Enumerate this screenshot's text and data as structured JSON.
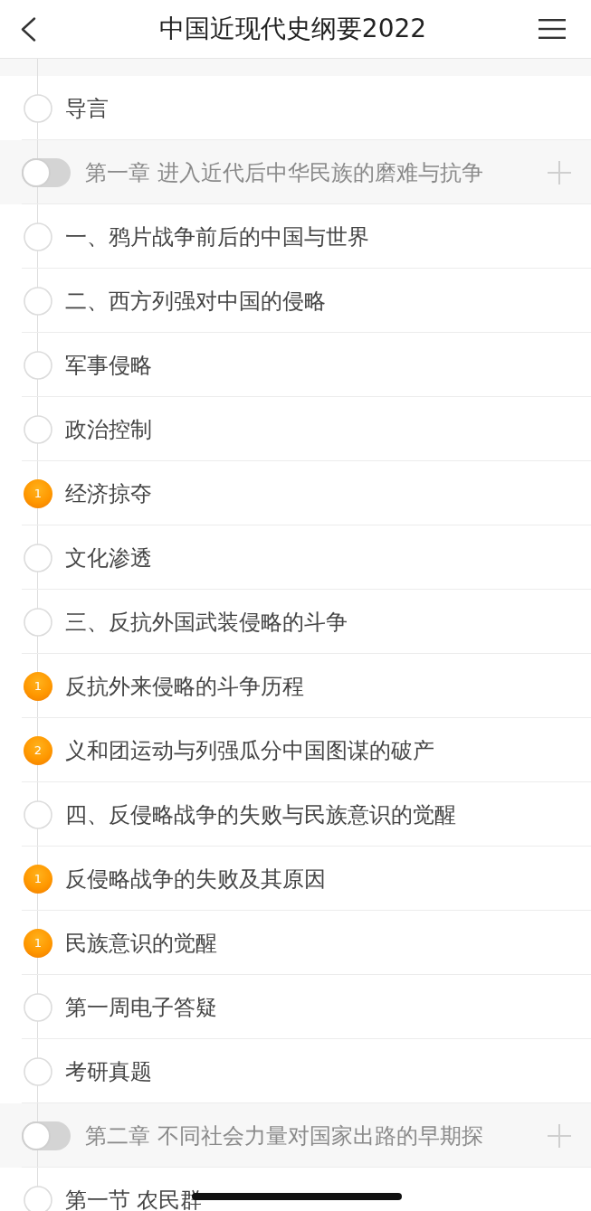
{
  "header": {
    "title": "中国近现代史纲要2022"
  },
  "outline": [
    {
      "kind": "lesson",
      "label": "导言"
    },
    {
      "kind": "chapter",
      "label": "第一章 进入近代后中华民族的磨难与抗争",
      "on": false
    },
    {
      "kind": "lesson",
      "label": "一、鸦片战争前后的中国与世界"
    },
    {
      "kind": "lesson",
      "label": "二、西方列强对中国的侵略"
    },
    {
      "kind": "lesson",
      "label": "军事侵略"
    },
    {
      "kind": "lesson",
      "label": "政治控制"
    },
    {
      "kind": "lesson",
      "label": "经济掠夺",
      "count": "1"
    },
    {
      "kind": "lesson",
      "label": "文化渗透"
    },
    {
      "kind": "lesson",
      "label": "三、反抗外国武装侵略的斗争"
    },
    {
      "kind": "lesson",
      "label": "反抗外来侵略的斗争历程",
      "count": "1"
    },
    {
      "kind": "lesson",
      "label": "义和团运动与列强瓜分中国图谋的破产",
      "count": "2"
    },
    {
      "kind": "lesson",
      "label": "四、反侵略战争的失败与民族意识的觉醒"
    },
    {
      "kind": "lesson",
      "label": "反侵略战争的失败及其原因",
      "count": "1"
    },
    {
      "kind": "lesson",
      "label": "民族意识的觉醒",
      "count": "1"
    },
    {
      "kind": "lesson",
      "label": "第一周电子答疑"
    },
    {
      "kind": "lesson",
      "label": "考研真题"
    },
    {
      "kind": "chapter",
      "label": "第二章 不同社会力量对国家出路的早期探",
      "on": false
    },
    {
      "kind": "lesson",
      "label": "第一节 农民群"
    }
  ]
}
